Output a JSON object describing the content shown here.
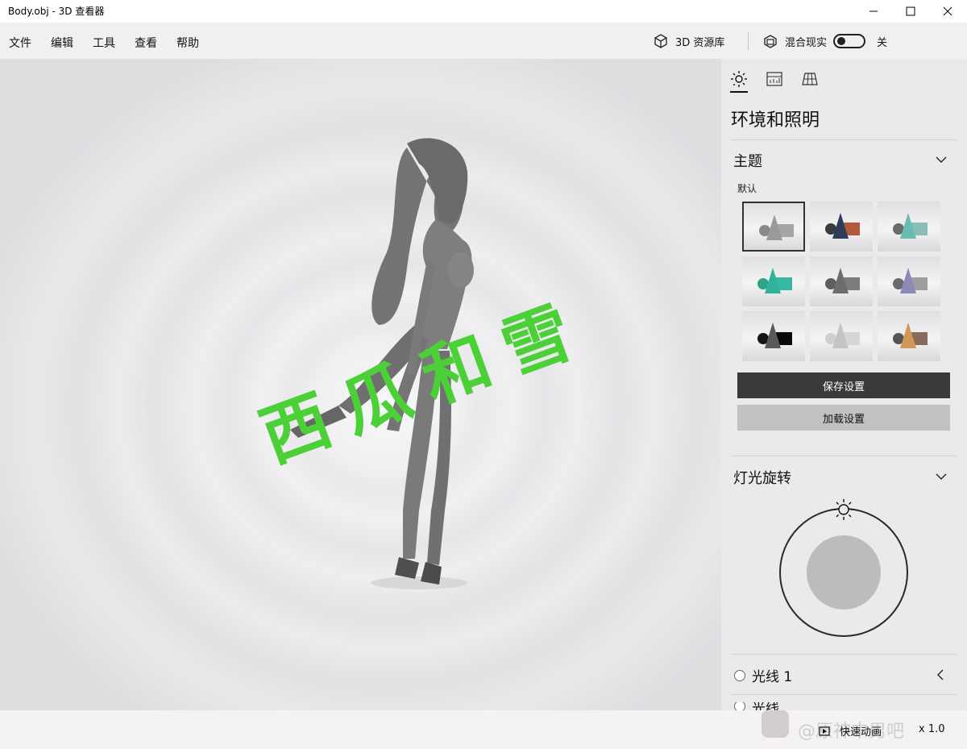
{
  "window": {
    "title": "Body.obj - 3D 查看器"
  },
  "menu": {
    "items": [
      "文件",
      "编辑",
      "工具",
      "查看",
      "帮助"
    ],
    "library_label": "3D 资源库",
    "mixed_reality_label": "混合现实",
    "mixed_reality_state": "关"
  },
  "viewport": {
    "watermark": "西瓜和雪"
  },
  "panel": {
    "tabs": [
      "sun-icon",
      "chart-icon",
      "grid-icon"
    ],
    "heading": "环境和照明",
    "theme": {
      "title": "主题",
      "default_label": "默认",
      "save_button": "保存设置",
      "load_button": "加载设置",
      "swatches": [
        {
          "sphere": "#8a8a8a",
          "cone": "#9a9a9a",
          "cube": "#a5a5a5",
          "selected": true
        },
        {
          "sphere": "#3b3b3b",
          "cone": "#2f3c58",
          "cube": "#b35a3d",
          "selected": false
        },
        {
          "sphere": "#6a6a6a",
          "cone": "#6bbcb0",
          "cube": "#8cbcb6",
          "selected": false
        },
        {
          "sphere": "#2da48c",
          "cone": "#2fb39a",
          "cube": "#39b7a0",
          "selected": false
        },
        {
          "sphere": "#5e5e5e",
          "cone": "#6d6d6d",
          "cube": "#7c7c7c",
          "selected": false
        },
        {
          "sphere": "#6b6b6b",
          "cone": "#8e8ab8",
          "cube": "#9d9d9d",
          "selected": false
        },
        {
          "sphere": "#151515",
          "cone": "#5a5a5a",
          "cube": "#0a0a0a",
          "selected": false
        },
        {
          "sphere": "#cfcfcf",
          "cone": "#c4c4c4",
          "cube": "#d6d6d6",
          "selected": false
        },
        {
          "sphere": "#555555",
          "cone": "#d4975a",
          "cube": "#8a6a5a",
          "selected": false
        }
      ]
    },
    "light_rotation": {
      "title": "灯光旋转"
    },
    "lights": [
      {
        "label": "光线 1"
      },
      {
        "label": "光线"
      }
    ]
  },
  "statusbar": {
    "animation_label": "快速动画",
    "speed_label": "x 1.0",
    "overlay_watermark": "@原神中男吧"
  }
}
